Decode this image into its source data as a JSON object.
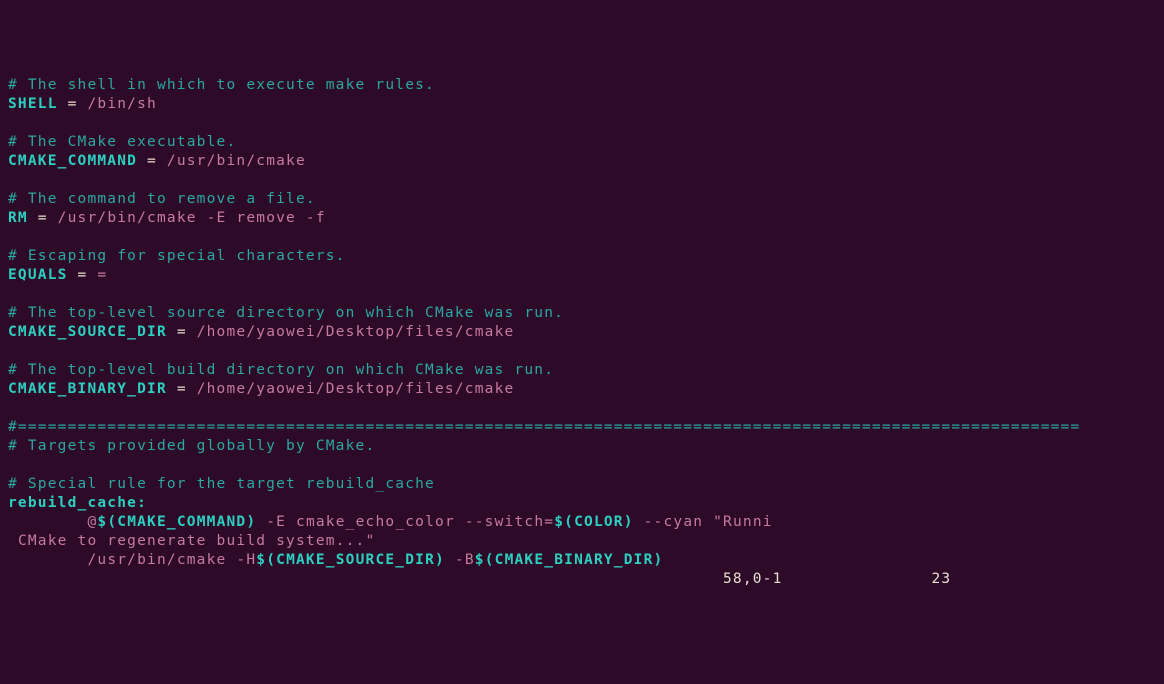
{
  "lines": {
    "c1": "# The shell in which to execute make rules.",
    "v1": "SHELL",
    "eq": " = ",
    "p1": "/bin/sh",
    "blank": "",
    "c2": "# The CMake executable.",
    "v2": "CMAKE_COMMAND",
    "p2": "/usr/bin/cmake",
    "c3": "# The command to remove a file.",
    "v3": "RM",
    "p3": "/usr/bin/cmake -E remove -f",
    "c4": "# Escaping for special characters.",
    "v4": "EQUALS",
    "p4": "=",
    "c5": "# The top-level source directory on which CMake was run.",
    "v5": "CMAKE_SOURCE_DIR",
    "p5": "/home/yaowei/Desktop/files/cmake",
    "c6": "# The top-level build directory on which CMake was run.",
    "v6": "CMAKE_BINARY_DIR",
    "p6": "/home/yaowei/Desktop/files/cmake",
    "sep": "#===========================================================================================================",
    "c7": "# Targets provided globally by CMake.",
    "c8": "# Special rule for the target rebuild_cache",
    "t1": "rebuild_cache:",
    "indent8": "        ",
    "at1": "@",
    "dollar_open": "$(",
    "ref_cmake_cmd": "CMAKE_COMMAND",
    "close_paren": ")",
    "cmd1a": " -E cmake_echo_color --switch=",
    "ref_color": "COLOR",
    "cmd1b": " --cyan ",
    "str1": "\"Runni",
    "wrap_prefix": " ",
    "wrap_txt": "CMake to regenerate build system...\"",
    "cmd2a": "/usr/bin/cmake -H",
    "ref_src": "CMAKE_SOURCE_DIR",
    "cmd2b": " -B",
    "ref_bin": "CMAKE_BINARY_DIR"
  },
  "status": {
    "pos": "58,0-1",
    "pct": "23"
  }
}
